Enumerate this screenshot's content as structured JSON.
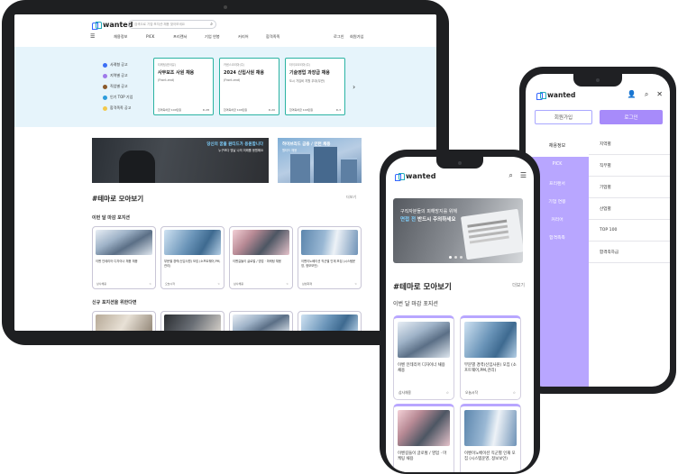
{
  "brand": {
    "logo_text": "wanted",
    "accent": "#3366ff",
    "secondary": "#a78bfa"
  },
  "tablet": {
    "search_placeholder": "검색으로 기업·포지션·채용 찾아보세요",
    "nav": [
      "채용정보",
      "PICK",
      "프리랜서",
      "기업 연봉",
      "커리어",
      "합격족족"
    ],
    "nav_right": [
      "로그인",
      "회원가입"
    ],
    "side_menu": [
      "사례형 공고",
      "지역별 공고",
      "직업별 공고",
      "인기 TOP 기업",
      "합격족족 공고"
    ],
    "hero_cards": [
      {
        "company": "티케팅(한국유)",
        "title": "사무보조 사원 채용",
        "sub": "(Front-end)",
        "foot": "합격축하금 100만원",
        "dday": "D-28"
      },
      {
        "company": "카센스코리아(주)",
        "title": "2024 신입사원 채용",
        "sub": "(Front-end)",
        "foot": "합격축하금 100만원",
        "dday": "D-20"
      },
      {
        "company": "타이코코리아(주)",
        "title": "기술영업 과장급 채용",
        "sub": "도시 가입비 지원 우대(무관)",
        "foot": "합격축하금 100만원",
        "dday": "D-3"
      }
    ],
    "banner1": {
      "title": "당신의 꿈을 원티드가 응원합니다",
      "sub": "누구보다 빛날 나의 미래를 응원해요"
    },
    "banner2": {
      "title": "하이브리드 금융 / 인턴 채용",
      "sub": "원티드 채용"
    },
    "section_title": "#테마로 모아보기",
    "more": "더보기",
    "sub1": "이번 달 마감 포지션",
    "jobs": [
      {
        "title": "이벤 인테리어 디자이너 채용 채용",
        "company": "상사채용"
      },
      {
        "title": "부문별 경력(신입사원) 모집 (소프트웨어,PM,관리)",
        "company": "오늘시작"
      },
      {
        "title": "이벤길들이 글로벌 / 영업 · 마케팅 채용",
        "company": "삼사채용"
      },
      {
        "title": "이벤이노베이션 직군별 인재 모집 (시스템운영, 정보보안)",
        "company": "삼성화재"
      }
    ],
    "sub2": "신규 포지션을 위한다면"
  },
  "phone_right": {
    "join": "회원가입",
    "login": "로그인",
    "left_menu": [
      "채용정보",
      "PICK",
      "프리랜서",
      "기업 연봉",
      "커리어",
      "합격족족"
    ],
    "right_menu": [
      "지역별",
      "직무별",
      "기업별",
      "산업별",
      "TOP 100",
      "합격족하금"
    ]
  },
  "phone_center": {
    "banner_line1": "구직자분들의 피해방지를 위해",
    "banner_hl": "면접 전",
    "banner_line2": "반드시 주의하세요",
    "section_title": "#테마로 모아보기",
    "more": "더보기",
    "sub": "이번 달 마감 포지션",
    "jobs": [
      {
        "title": "이벤 인테리어 디자이너 채용 채용",
        "company": "삼사채용"
      },
      {
        "title": "부문별 경력(신입사원) 모집 (소프트웨어,PM,관리)",
        "company": "오늘시작"
      },
      {
        "title": "이벤길들이 글로벌 / 영업 · 마케팅 채용",
        "company": ""
      },
      {
        "title": "이벤이노베이션 직군별 인재 모집 (시스템운영, 정보보안)",
        "company": ""
      }
    ]
  }
}
